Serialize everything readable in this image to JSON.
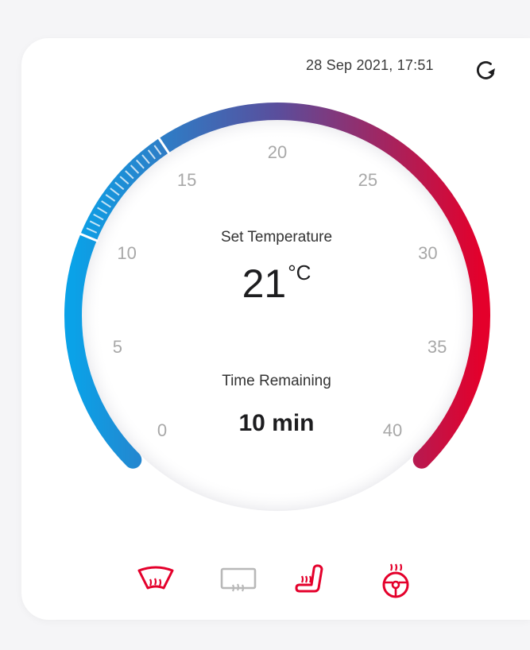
{
  "header": {
    "timestamp": "28 Sep 2021, 17:51"
  },
  "dial": {
    "scale_min": 0,
    "scale_max": 40,
    "tick_labels": [
      "0",
      "5",
      "10",
      "15",
      "20",
      "25",
      "30",
      "35",
      "40"
    ],
    "selected_range": [
      10,
      15
    ],
    "gradient_start": "#0aa2e8",
    "gradient_mid": "#5a4e9c",
    "gradient_end": "#e4002b"
  },
  "set_temperature": {
    "label": "Set Temperature",
    "value": "21",
    "unit": "°C"
  },
  "time_remaining": {
    "label": "Time Remaining",
    "value": "10 min"
  },
  "controls": {
    "front_defrost_icon": "front-windshield-defrost-icon",
    "rear_defrost_icon": "rear-window-defrost-icon",
    "seat_heater_icon": "seat-heater-icon",
    "steering_wheel_heater_icon": "steering-wheel-heater-icon",
    "active_color": "#e4002b",
    "inactive_color": "#b8b8b8",
    "states": {
      "front_defrost": "on",
      "rear_defrost": "off",
      "seat_heater": "on",
      "steering_wheel_heater": "on"
    }
  }
}
